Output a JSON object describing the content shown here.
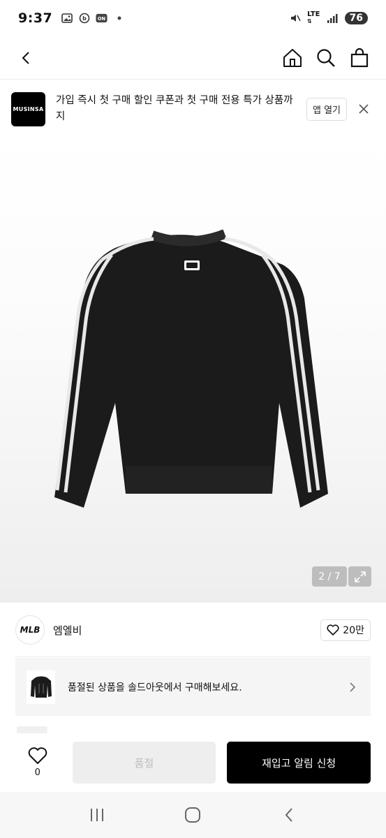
{
  "status": {
    "time": "9:37",
    "network": "LTE",
    "battery": "76"
  },
  "header": {
    "back_icon": "chevron-left-icon",
    "home_icon": "home-icon",
    "search_icon": "search-icon",
    "cart_icon": "shopping-bag-icon"
  },
  "banner": {
    "logo_text": "MUSINSA",
    "message": "가입 즉시 첫 구매 할인 쿠폰과 첫 구매 전용 특가 상품까지",
    "open_label": "앱 열기"
  },
  "gallery": {
    "pager": "2 / 7"
  },
  "brand": {
    "logo_text": "MLB",
    "name": "엠엘비",
    "likes": "20만"
  },
  "soldout_card": {
    "message": "품절된 상품을 솔드아웃에서 구매해보세요."
  },
  "actions": {
    "wish_count": "0",
    "soldout_label": "품절",
    "restock_label": "재입고 알림 신청"
  },
  "colors": {
    "primary": "#000000",
    "disabled_bg": "#eeeeee",
    "disabled_text": "#bdbdbd"
  }
}
